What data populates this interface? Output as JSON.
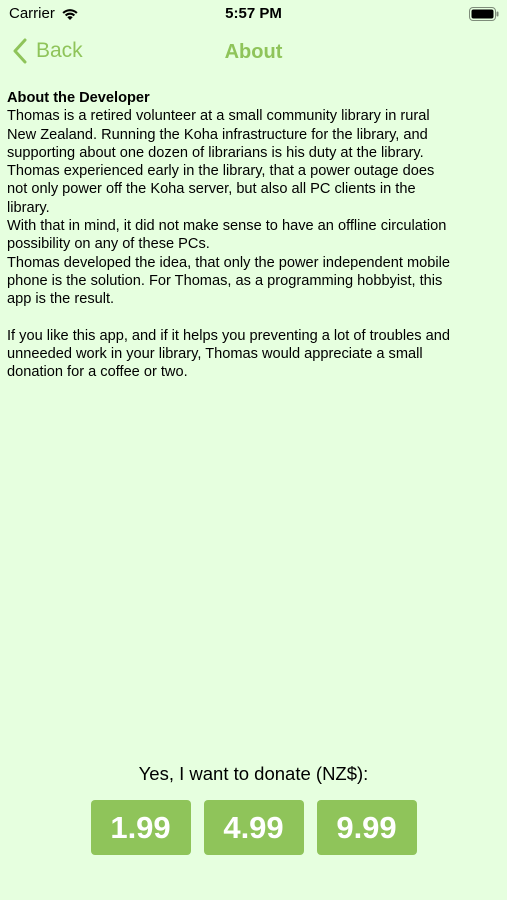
{
  "status_bar": {
    "carrier": "Carrier",
    "time": "5:57 PM"
  },
  "nav": {
    "back_label": "Back",
    "title": "About",
    "accent_color": "#8fc45a"
  },
  "content": {
    "heading": "About the Developer",
    "paragraphs": [
      "Thomas is a retired volunteer at a small community library in rural New Zealand. Running the Koha infrastructure for the library, and supporting about one dozen of librarians is his duty at the library.",
      "Thomas experienced early in the library, that a power outage does not only power off the Koha server, but also all PC clients in the library.",
      "With that in mind, it did not make sense to have an offline circulation possibility on any of these PCs.",
      "Thomas developed the idea, that only the power independent mobile phone is the solution. For Thomas, as a programming hobbyist, this app is the result.",
      "If you like this app, and if it helps you preventing a lot of troubles and unneeded work in your library, Thomas would appreciate a small donation for a coffee or two."
    ]
  },
  "donate": {
    "label": "Yes, I want to donate (NZ$):",
    "amounts": [
      "1.99",
      "4.99",
      "9.99"
    ]
  },
  "colors": {
    "background": "#e6ffdf",
    "accent": "#8fc45a"
  }
}
